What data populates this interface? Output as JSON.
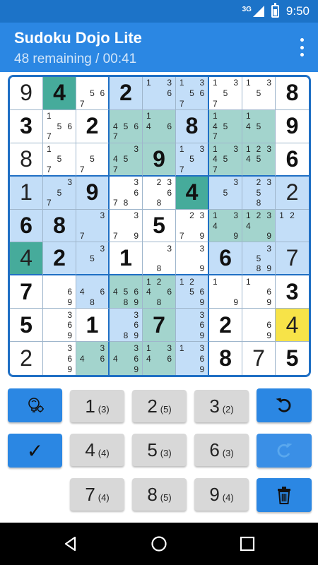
{
  "status_bar": {
    "network": "3G",
    "time": "9:50"
  },
  "app_bar": {
    "title": "Sudoku Dojo Lite",
    "subtitle": "48 remaining / 00:41",
    "menu_icon": "overflow-menu-icon"
  },
  "colors": {
    "primary": "#2b87e3",
    "status": "#1c73c8",
    "highlight": "#c3def8",
    "teal": "#a3d4cd",
    "teal_dark": "#46ab9b",
    "selected": "#f7e348",
    "key_gray": "#d8d8d8",
    "board_border": "#1f6fc4"
  },
  "board": {
    "values": [
      [
        "9",
        "4",
        "",
        "2",
        "",
        "",
        "",
        "",
        "8"
      ],
      [
        "3",
        "",
        "2",
        "",
        "",
        "8",
        "",
        "",
        "9"
      ],
      [
        "8",
        "",
        "",
        "",
        "9",
        "",
        "",
        "",
        "6"
      ],
      [
        "1",
        "",
        "9",
        "",
        "",
        "4",
        "",
        "",
        "2"
      ],
      [
        "6",
        "8",
        "",
        "",
        "5",
        "",
        "",
        "",
        ""
      ],
      [
        "4",
        "2",
        "",
        "1",
        "",
        "",
        "6",
        "",
        "7"
      ],
      [
        "7",
        "",
        "",
        "",
        "",
        "",
        "",
        "",
        "3"
      ],
      [
        "5",
        "",
        "1",
        "",
        "7",
        "",
        "2",
        "",
        "4"
      ],
      [
        "2",
        "",
        "",
        "",
        "",
        "",
        "8",
        "7",
        "5"
      ]
    ],
    "given": [
      [
        0,
        1,
        0,
        1,
        0,
        0,
        0,
        0,
        1
      ],
      [
        1,
        0,
        1,
        0,
        0,
        1,
        0,
        0,
        1
      ],
      [
        0,
        0,
        0,
        0,
        1,
        0,
        0,
        0,
        1
      ],
      [
        0,
        0,
        1,
        0,
        0,
        1,
        0,
        0,
        0
      ],
      [
        1,
        1,
        0,
        0,
        1,
        0,
        0,
        0,
        0
      ],
      [
        0,
        1,
        0,
        1,
        0,
        0,
        1,
        0,
        0
      ],
      [
        1,
        0,
        0,
        0,
        0,
        0,
        0,
        0,
        1
      ],
      [
        1,
        0,
        1,
        0,
        1,
        0,
        1,
        0,
        0
      ],
      [
        0,
        0,
        0,
        0,
        0,
        0,
        1,
        0,
        1
      ]
    ],
    "notes": [
      [
        [],
        [],
        [
          "5",
          "6",
          "7"
        ],
        [],
        [
          "1",
          "3",
          "6"
        ],
        [
          "1",
          "3",
          "5",
          "6",
          "7"
        ],
        [
          "1",
          "3",
          "5",
          "7"
        ],
        [
          "1",
          "3",
          "5"
        ],
        []
      ],
      [
        [],
        [
          "1",
          "5",
          "6",
          "7"
        ],
        [],
        [
          "4",
          "5",
          "6",
          "7"
        ],
        [
          "1",
          "4",
          "6"
        ],
        [],
        [
          "1",
          "4",
          "5",
          "7"
        ],
        [
          "1",
          "4",
          "5"
        ],
        []
      ],
      [
        [],
        [
          "1",
          "5",
          "7"
        ],
        [
          "5",
          "7"
        ],
        [
          "3",
          "4",
          "5",
          "7"
        ],
        [],
        [
          "1",
          "3",
          "5",
          "7"
        ],
        [
          "1",
          "3",
          "4",
          "5",
          "7"
        ],
        [
          "1",
          "2",
          "3",
          "4",
          "5"
        ],
        []
      ],
      [
        [],
        [
          "3",
          "5",
          "7"
        ],
        [],
        [
          "3",
          "6",
          "7",
          "8"
        ],
        [
          "2",
          "3",
          "6",
          "8"
        ],
        [],
        [
          "3",
          "5"
        ],
        [
          "2",
          "3",
          "5",
          "8"
        ],
        []
      ],
      [
        [],
        [],
        [
          "3",
          "7"
        ],
        [
          "3",
          "7",
          "9"
        ],
        [],
        [
          "2",
          "3",
          "7",
          "9"
        ],
        [
          "1",
          "3",
          "4",
          "9"
        ],
        [
          "1",
          "2",
          "3",
          "4",
          "9"
        ],
        [
          "1",
          "2"
        ]
      ],
      [
        [],
        [],
        [
          "3",
          "5"
        ],
        [],
        [
          "3",
          "8"
        ],
        [
          "3",
          "9"
        ],
        [],
        [
          "3",
          "5",
          "8",
          "9"
        ],
        []
      ],
      [
        [],
        [
          "6",
          "9"
        ],
        [
          "4",
          "6",
          "8"
        ],
        [
          "4",
          "5",
          "6",
          "8",
          "9"
        ],
        [
          "1",
          "2",
          "4",
          "6",
          "8"
        ],
        [
          "1",
          "2",
          "5",
          "6",
          "9"
        ],
        [
          "1",
          "9"
        ],
        [
          "1",
          "6",
          "9"
        ],
        []
      ],
      [
        [],
        [
          "3",
          "6",
          "9"
        ],
        [],
        [
          "3",
          "6",
          "8",
          "9"
        ],
        [],
        [
          "3",
          "6",
          "9"
        ],
        [],
        [
          "6",
          "9"
        ],
        []
      ],
      [
        [],
        [
          "3",
          "6",
          "9"
        ],
        [
          "3",
          "4",
          "6"
        ],
        [
          "3",
          "4",
          "6",
          "9"
        ],
        [
          "1",
          "3",
          "4",
          "6"
        ],
        [
          "1",
          "3",
          "6",
          "9"
        ],
        [],
        [],
        []
      ]
    ],
    "shading": [
      [
        "w",
        "D",
        "w",
        "h",
        "h",
        "h",
        "w",
        "w",
        "w"
      ],
      [
        "w",
        "w",
        "w",
        "T",
        "T",
        "h",
        "T",
        "T",
        "w"
      ],
      [
        "w",
        "w",
        "w",
        "T",
        "T",
        "h",
        "T",
        "T",
        "w"
      ],
      [
        "h",
        "h",
        "h",
        "w",
        "w",
        "D",
        "h",
        "h",
        "h"
      ],
      [
        "h",
        "h",
        "h",
        "w",
        "w",
        "w",
        "T",
        "T",
        "h"
      ],
      [
        "D",
        "h",
        "h",
        "w",
        "w",
        "w",
        "h",
        "h",
        "h"
      ],
      [
        "w",
        "w",
        "h",
        "T",
        "T",
        "h",
        "w",
        "w",
        "w"
      ],
      [
        "w",
        "w",
        "w",
        "h",
        "T",
        "h",
        "w",
        "w",
        "Y"
      ],
      [
        "w",
        "w",
        "T",
        "T",
        "T",
        "h",
        "w",
        "w",
        "w"
      ]
    ]
  },
  "keypad": {
    "hint_icon": "lightbulb-icon",
    "check_label": "✓",
    "undo_icon": "undo-icon",
    "redo_icon": "redo-icon",
    "delete_icon": "trash-icon",
    "digits": [
      {
        "num": "1",
        "count": "(3)"
      },
      {
        "num": "2",
        "count": "(5)"
      },
      {
        "num": "3",
        "count": "(2)"
      },
      {
        "num": "4",
        "count": "(4)"
      },
      {
        "num": "5",
        "count": "(3)"
      },
      {
        "num": "6",
        "count": "(3)"
      },
      {
        "num": "7",
        "count": "(4)"
      },
      {
        "num": "8",
        "count": "(5)"
      },
      {
        "num": "9",
        "count": "(4)"
      }
    ]
  },
  "nav": {
    "back_icon": "back-icon",
    "home_icon": "home-icon",
    "recents_icon": "recents-icon"
  }
}
